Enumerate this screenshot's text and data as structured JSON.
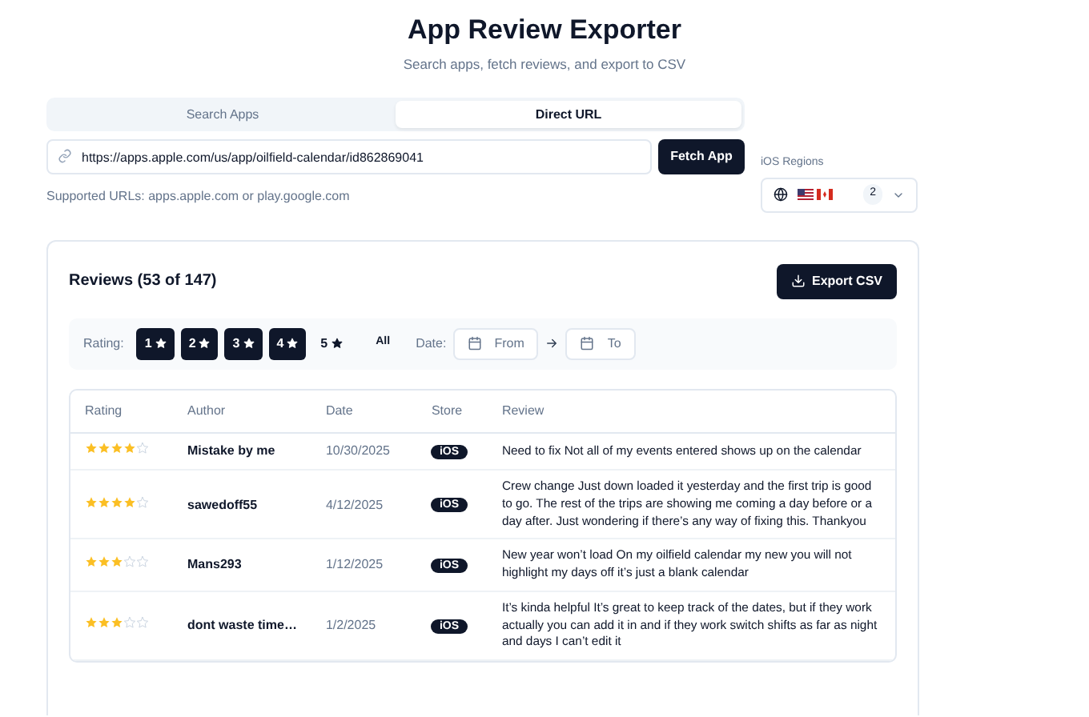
{
  "header": {
    "title": "App Review Exporter",
    "subtitle": "Search apps, fetch reviews, and export to CSV"
  },
  "tabs": [
    {
      "label": "Search Apps",
      "selected": false
    },
    {
      "label": "Direct URL",
      "selected": true
    }
  ],
  "url_field": {
    "value": "https://apps.apple.com/us/app/oilfield-calendar/id862869041"
  },
  "fetch_button": "Fetch App",
  "hint": "Supported URLs: apps.apple.com or play.google.com",
  "regions": {
    "label": "iOS Regions",
    "count": "2"
  },
  "reviews": {
    "title": "Reviews (53 of 147)",
    "export_button": "Export CSV",
    "filters": {
      "rating_label": "Rating:",
      "ratings": [
        {
          "label": "1",
          "selected": true
        },
        {
          "label": "2",
          "selected": true
        },
        {
          "label": "3",
          "selected": true
        },
        {
          "label": "4",
          "selected": true
        },
        {
          "label": "5",
          "selected": false
        }
      ],
      "all_button": "All",
      "date_label": "Date:",
      "from": "From",
      "to": "To"
    },
    "columns": [
      "Rating",
      "Author",
      "Date",
      "Store",
      "Review"
    ],
    "rows": [
      {
        "stars": 4,
        "author": "Mistake by me",
        "date": "10/30/2025",
        "store": "iOS",
        "review": "Need to fix Not all of my events entered shows up on the calendar"
      },
      {
        "stars": 4,
        "author": "sawedoff55",
        "date": "4/12/2025",
        "store": "iOS",
        "review": "Crew change Just down loaded it yesterday and the first trip is good to go. The rest of the trips are showing me coming a day before or a day after. Just wondering if there’s any way of fixing this. Thankyou"
      },
      {
        "stars": 3,
        "author": "Mans293",
        "date": "1/12/2025",
        "store": "iOS",
        "review": "New year won’t load On my oilfield calendar my new you will not highlight my days off it’s just a blank calendar"
      },
      {
        "stars": 3,
        "author": "dont waste time…",
        "date": "1/2/2025",
        "store": "iOS",
        "review": "It’s kinda helpful It’s great to keep track of the dates, but if they work actually you can add it in and if they work switch shifts as far as night and days I can’t edit it"
      }
    ]
  }
}
